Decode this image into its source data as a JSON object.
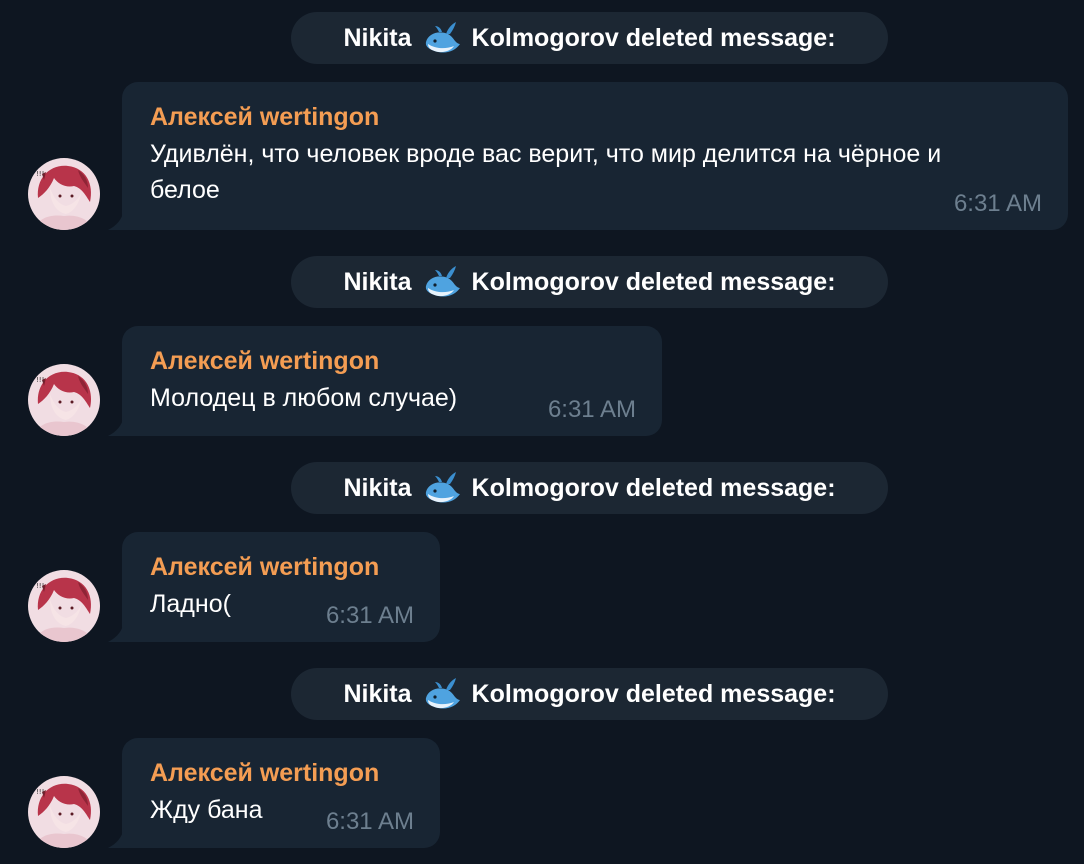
{
  "chat": {
    "events": [
      {
        "type": "service",
        "name_first": "Nikita",
        "emoji": "whale-icon",
        "name_rest": "Kolmogorov deleted message:"
      },
      {
        "type": "message",
        "sender": "Алексей wertingon",
        "text": "Удивлён, что человек вроде вас верит, что мир делится на чёрное и белое",
        "time": "6:31 AM"
      },
      {
        "type": "service",
        "name_first": "Nikita",
        "emoji": "whale-icon",
        "name_rest": "Kolmogorov deleted message:"
      },
      {
        "type": "message",
        "sender": "Алексей wertingon",
        "text": "Молодец в любом случае)",
        "time": "6:31 AM"
      },
      {
        "type": "service",
        "name_first": "Nikita",
        "emoji": "whale-icon",
        "name_rest": "Kolmogorov deleted message:"
      },
      {
        "type": "message",
        "sender": "Алексей wertingon",
        "text": "Ладно(",
        "time": "6:31 AM"
      },
      {
        "type": "service",
        "name_first": "Nikita",
        "emoji": "whale-icon",
        "name_rest": "Kolmogorov deleted message:"
      },
      {
        "type": "message",
        "sender": "Алексей wertingon",
        "text": "Жду бана",
        "time": "6:31 AM"
      }
    ]
  },
  "colors": {
    "background": "#0e1621",
    "bubble": "#182533",
    "service_pill": "#1c2733",
    "sender_name": "#f49d53",
    "time": "#6d7f8f"
  }
}
